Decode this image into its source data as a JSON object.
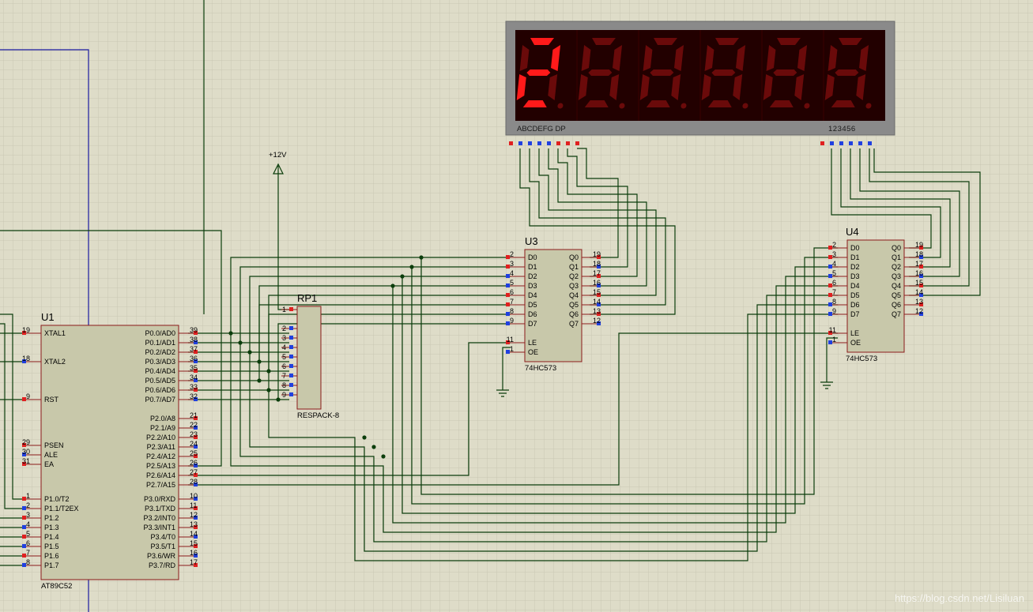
{
  "display": {
    "segment_label": "ABCDEFG  DP",
    "digit_label": "123456",
    "digits": [
      "2",
      "8",
      "8",
      "8",
      "8",
      "8"
    ],
    "digits_lit": [
      true,
      false,
      false,
      false,
      false,
      false
    ]
  },
  "u1": {
    "ref": "U1",
    "part": "AT89C52",
    "left_pins": [
      {
        "num": "19",
        "name": "XTAL1"
      },
      {
        "num": "18",
        "name": "XTAL2"
      },
      {
        "num": "9",
        "name": "RST"
      },
      {
        "num": "29",
        "name": "PSEN"
      },
      {
        "num": "30",
        "name": "ALE"
      },
      {
        "num": "31",
        "name": "EA"
      },
      {
        "num": "1",
        "name": "P1.0/T2"
      },
      {
        "num": "2",
        "name": "P1.1/T2EX"
      },
      {
        "num": "3",
        "name": "P1.2"
      },
      {
        "num": "4",
        "name": "P1.3"
      },
      {
        "num": "5",
        "name": "P1.4"
      },
      {
        "num": "6",
        "name": "P1.5"
      },
      {
        "num": "7",
        "name": "P1.6"
      },
      {
        "num": "8",
        "name": "P1.7"
      }
    ],
    "right_pins": [
      {
        "num": "39",
        "name": "P0.0/AD0"
      },
      {
        "num": "38",
        "name": "P0.1/AD1"
      },
      {
        "num": "37",
        "name": "P0.2/AD2"
      },
      {
        "num": "36",
        "name": "P0.3/AD3"
      },
      {
        "num": "35",
        "name": "P0.4/AD4"
      },
      {
        "num": "34",
        "name": "P0.5/AD5"
      },
      {
        "num": "33",
        "name": "P0.6/AD6"
      },
      {
        "num": "32",
        "name": "P0.7/AD7"
      },
      {
        "num": "21",
        "name": "P2.0/A8"
      },
      {
        "num": "22",
        "name": "P2.1/A9"
      },
      {
        "num": "23",
        "name": "P2.2/A10"
      },
      {
        "num": "24",
        "name": "P2.3/A11"
      },
      {
        "num": "25",
        "name": "P2.4/A12"
      },
      {
        "num": "26",
        "name": "P2.5/A13"
      },
      {
        "num": "27",
        "name": "P2.6/A14"
      },
      {
        "num": "28",
        "name": "P2.7/A15"
      },
      {
        "num": "10",
        "name": "P3.0/RXD"
      },
      {
        "num": "11",
        "name": "P3.1/TXD"
      },
      {
        "num": "12",
        "name": "P3.2/INT0"
      },
      {
        "num": "13",
        "name": "P3.3/INT1"
      },
      {
        "num": "14",
        "name": "P3.4/T0"
      },
      {
        "num": "15",
        "name": "P3.5/T1"
      },
      {
        "num": "16",
        "name": "P3.6/WR"
      },
      {
        "num": "17",
        "name": "P3.7/RD"
      }
    ]
  },
  "rp1": {
    "ref": "RP1",
    "part": "RESPACK-8",
    "pins": [
      "1",
      "2",
      "3",
      "4",
      "5",
      "6",
      "7",
      "8",
      "9"
    ]
  },
  "power": {
    "label": "+12V"
  },
  "latches": [
    {
      "ref": "U3",
      "part": "74HC573",
      "left_pins": [
        {
          "num": "2",
          "name": "D0"
        },
        {
          "num": "3",
          "name": "D1"
        },
        {
          "num": "4",
          "name": "D2"
        },
        {
          "num": "5",
          "name": "D3"
        },
        {
          "num": "6",
          "name": "D4"
        },
        {
          "num": "7",
          "name": "D5"
        },
        {
          "num": "8",
          "name": "D6"
        },
        {
          "num": "9",
          "name": "D7"
        },
        {
          "num": "11",
          "name": "LE"
        },
        {
          "num": "1",
          "name": "OE"
        }
      ],
      "right_pins": [
        {
          "num": "19",
          "name": "Q0"
        },
        {
          "num": "18",
          "name": "Q1"
        },
        {
          "num": "17",
          "name": "Q2"
        },
        {
          "num": "16",
          "name": "Q3"
        },
        {
          "num": "15",
          "name": "Q4"
        },
        {
          "num": "14",
          "name": "Q5"
        },
        {
          "num": "13",
          "name": "Q6"
        },
        {
          "num": "12",
          "name": "Q7"
        }
      ]
    },
    {
      "ref": "U4",
      "part": "74HC573",
      "left_pins": [
        {
          "num": "2",
          "name": "D0"
        },
        {
          "num": "3",
          "name": "D1"
        },
        {
          "num": "4",
          "name": "D2"
        },
        {
          "num": "5",
          "name": "D3"
        },
        {
          "num": "6",
          "name": "D4"
        },
        {
          "num": "7",
          "name": "D5"
        },
        {
          "num": "8",
          "name": "D6"
        },
        {
          "num": "9",
          "name": "D7"
        },
        {
          "num": "11",
          "name": "LE"
        },
        {
          "num": "1",
          "name": "OE"
        }
      ],
      "right_pins": [
        {
          "num": "19",
          "name": "Q0"
        },
        {
          "num": "18",
          "name": "Q1"
        },
        {
          "num": "17",
          "name": "Q2"
        },
        {
          "num": "16",
          "name": "Q3"
        },
        {
          "num": "15",
          "name": "Q4"
        },
        {
          "num": "14",
          "name": "Q5"
        },
        {
          "num": "13",
          "name": "Q6"
        },
        {
          "num": "12",
          "name": "Q7"
        }
      ]
    }
  ],
  "watermark": "https://blog.csdn.net/Lisiluan",
  "colors": {
    "background": "#dedcc8",
    "grid": "#c9c7b3",
    "chip_body": "#c8c8aa",
    "chip_border": "#8b1a1a",
    "wire": "#0b3d0b",
    "pin_red": "#e02020",
    "pin_blue": "#2040e0",
    "segment_on": "#ff1a1a",
    "segment_off": "#6a0a0a",
    "display_frame": "#8a8a8a",
    "display_face": "#220000"
  }
}
